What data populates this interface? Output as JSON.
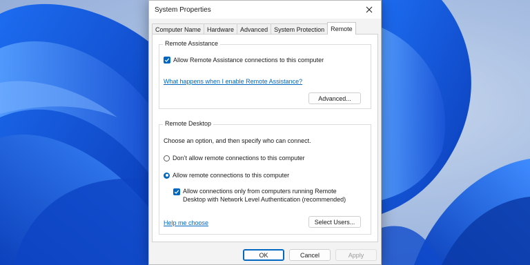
{
  "window": {
    "title": "System Properties",
    "close_icon": "close-icon"
  },
  "tabs": [
    {
      "label": "Computer Name",
      "active": false
    },
    {
      "label": "Hardware",
      "active": false
    },
    {
      "label": "Advanced",
      "active": false
    },
    {
      "label": "System Protection",
      "active": false
    },
    {
      "label": "Remote",
      "active": true
    }
  ],
  "remote_assistance": {
    "group_label": "Remote Assistance",
    "allow_checkbox": {
      "label": "Allow Remote Assistance connections to this computer",
      "checked": true
    },
    "help_link": "What happens when I enable Remote Assistance?",
    "advanced_button": "Advanced..."
  },
  "remote_desktop": {
    "group_label": "Remote Desktop",
    "instruction": "Choose an option, and then specify who can connect.",
    "options": [
      {
        "label": "Don’t allow remote connections to this computer",
        "selected": false
      },
      {
        "label": "Allow remote connections to this computer",
        "selected": true
      }
    ],
    "nla_checkbox": {
      "line1": "Allow connections only from computers running Remote",
      "line2": "Desktop with Network Level Authentication (recommended)",
      "checked": true
    },
    "help_link": "Help me choose",
    "select_users_button": "Select Users..."
  },
  "footer": {
    "ok": "OK",
    "cancel": "Cancel",
    "apply": "Apply",
    "apply_enabled": false
  },
  "colors": {
    "accent": "#0067c0",
    "wallpaper_blue": "#1f5fd6"
  }
}
